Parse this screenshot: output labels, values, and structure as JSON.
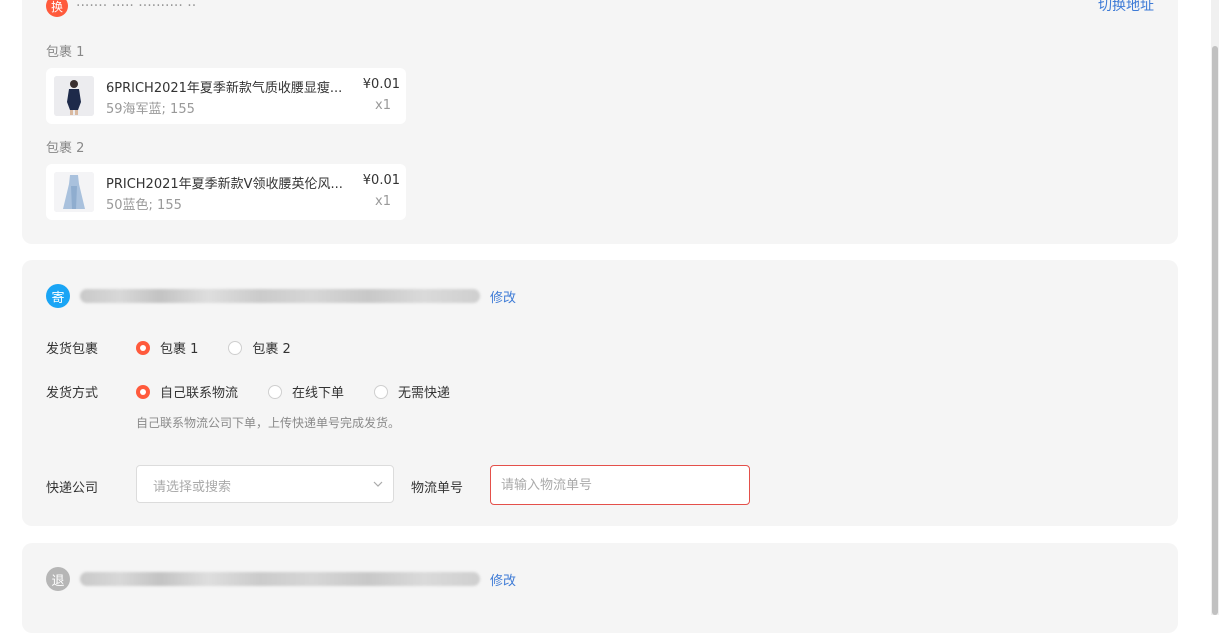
{
  "package_card": {
    "top_badge": "换",
    "top_text": "·······  ·····  ··········  ··",
    "top_link": "切换地址",
    "packages": [
      {
        "label": "包裹 1",
        "title": "6PRICH2021年夏季新款气质收腰显瘦...",
        "sku": "59海军蓝; 155",
        "price": "¥0.01",
        "qty": "x1"
      },
      {
        "label": "包裹 2",
        "title": "PRICH2021年夏季新款V领收腰英伦风...",
        "sku": "50蓝色; 155",
        "price": "¥0.01",
        "qty": "x1"
      }
    ]
  },
  "ship_card": {
    "badge": "寄",
    "edit": "修改",
    "package_label": "发货包裹",
    "package_options": [
      "包裹 1",
      "包裹 2"
    ],
    "package_selected": 0,
    "method_label": "发货方式",
    "method_options": [
      "自己联系物流",
      "在线下单",
      "无需快递"
    ],
    "method_selected": 0,
    "hint": "自己联系物流公司下单，上传快递单号完成发货。",
    "courier_label": "快递公司",
    "courier_placeholder": "请选择或搜索",
    "tracking_label": "物流单号",
    "tracking_placeholder": "请输入物流单号"
  },
  "return_card": {
    "badge": "退",
    "edit": "修改"
  },
  "colors": {
    "accent": "#ff5a3c",
    "link": "#3e7bd6",
    "ship_badge": "#1aa5f5",
    "return_badge": "#b6b6b6",
    "error_border": "#e4504a"
  }
}
